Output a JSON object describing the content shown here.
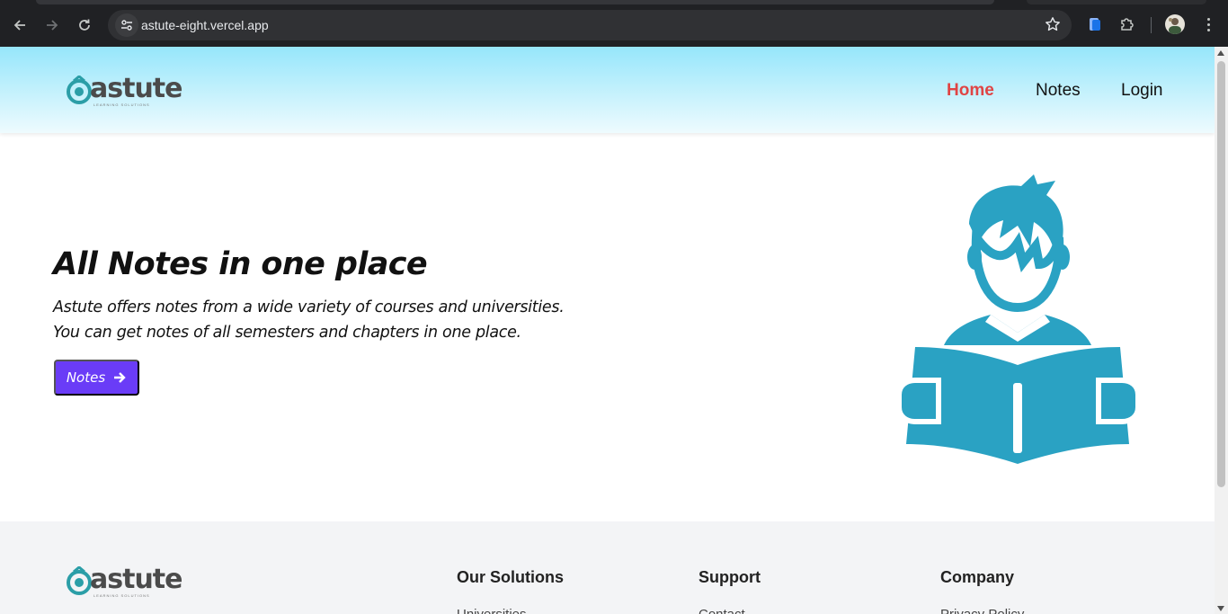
{
  "browser": {
    "url": "astute-eight.vercel.app"
  },
  "header": {
    "logo_text": "astute",
    "logo_tagline": "LEARNING SOLUTIONS",
    "nav": [
      {
        "label": "Home",
        "active": true
      },
      {
        "label": "Notes",
        "active": false
      },
      {
        "label": "Login",
        "active": false
      }
    ]
  },
  "hero": {
    "title_pre": "All ",
    "title_bold": "Notes",
    "title_post": " in one place",
    "description": "Astute offers notes from a wide variety of courses and universities. You can get notes of all semesters and chapters in one place.",
    "button_label": "Notes",
    "illustration_color": "#2aa2c3"
  },
  "footer": {
    "columns": [
      {
        "title": "Our Solutions",
        "first_link": "Universities"
      },
      {
        "title": "Support",
        "first_link": "Contact"
      },
      {
        "title": "Company",
        "first_link": "Privacy Policy"
      }
    ]
  },
  "colors": {
    "accent_button": "#6a3cf7",
    "nav_active": "#e04444",
    "header_gradient_top": "#96e6fb",
    "footer_bg": "#f3f4f6"
  }
}
